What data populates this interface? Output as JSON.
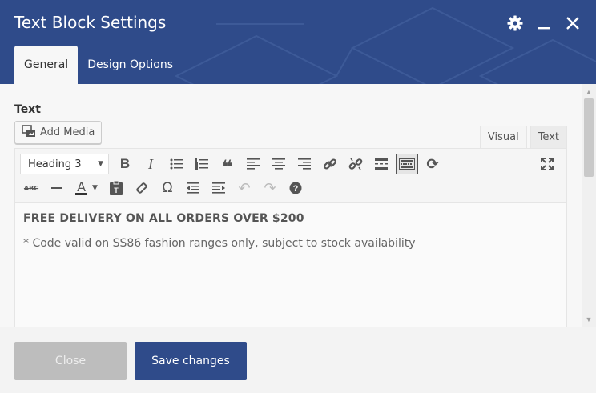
{
  "window": {
    "title": "Text Block Settings"
  },
  "tabs": [
    {
      "label": "General",
      "active": true
    },
    {
      "label": "Design Options",
      "active": false
    }
  ],
  "field": {
    "label": "Text"
  },
  "add_media": {
    "label": "Add Media"
  },
  "editor_tabs": [
    {
      "label": "Visual",
      "active": true
    },
    {
      "label": "Text",
      "active": false
    }
  ],
  "toolbar": {
    "format_select": "Heading 3",
    "row1": [
      "bold-icon",
      "italic-icon",
      "bulleted-list-icon",
      "numbered-list-icon",
      "blockquote-icon",
      "align-left-icon",
      "align-center-icon",
      "align-right-icon",
      "link-icon",
      "unlink-icon",
      "read-more-icon",
      "toolbar-toggle-icon",
      "refresh-icon"
    ],
    "row2": [
      "strikethrough-icon",
      "horizontal-line-icon",
      "text-color-icon",
      "paste-text-icon",
      "clear-formatting-icon",
      "special-character-icon",
      "outdent-icon",
      "indent-icon",
      "undo-icon",
      "redo-icon",
      "help-icon"
    ]
  },
  "content": {
    "heading": "FREE DELIVERY ON ALL ORDERS OVER $200",
    "paragraph": "* Code valid on SS86 fashion ranges only, subject to stock availability"
  },
  "footer": {
    "close_label": "Close",
    "save_label": "Save changes"
  },
  "colors": {
    "header": "#2f4b8a",
    "primary_button": "#2f4b8a",
    "disabled_button": "#bdbdbd"
  }
}
